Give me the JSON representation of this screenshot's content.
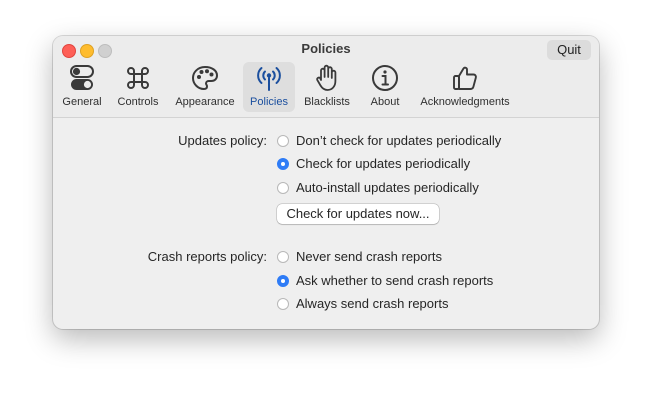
{
  "window": {
    "title": "Policies",
    "quit_label": "Quit"
  },
  "tabs": [
    {
      "label": "General",
      "icon": "toggle-switches-icon"
    },
    {
      "label": "Controls",
      "icon": "command-key-icon"
    },
    {
      "label": "Appearance",
      "icon": "palette-icon"
    },
    {
      "label": "Policies",
      "icon": "antenna-broadcast-icon",
      "active": true
    },
    {
      "label": "Blacklists",
      "icon": "raised-hand-icon"
    },
    {
      "label": "About",
      "icon": "info-circle-icon"
    },
    {
      "label": "Acknowledgments",
      "icon": "thumbs-up-icon"
    }
  ],
  "updates": {
    "label": "Updates policy:",
    "options": [
      {
        "label": "Don’t check for updates periodically",
        "selected": false
      },
      {
        "label": "Check for updates periodically",
        "selected": true
      },
      {
        "label": "Auto-install updates periodically",
        "selected": false
      }
    ],
    "check_button": "Check for updates now..."
  },
  "crash": {
    "label": "Crash reports policy:",
    "options": [
      {
        "label": "Never send crash reports",
        "selected": false
      },
      {
        "label": "Ask whether to send crash reports",
        "selected": true
      },
      {
        "label": "Always send crash reports",
        "selected": false
      }
    ]
  },
  "colors": {
    "accent": "#2f7cf6",
    "active_tab_text": "#1b4f9e",
    "close": "#fe5f57",
    "minimize": "#febc2e",
    "zoom_disabled": "#d0d0d0"
  }
}
